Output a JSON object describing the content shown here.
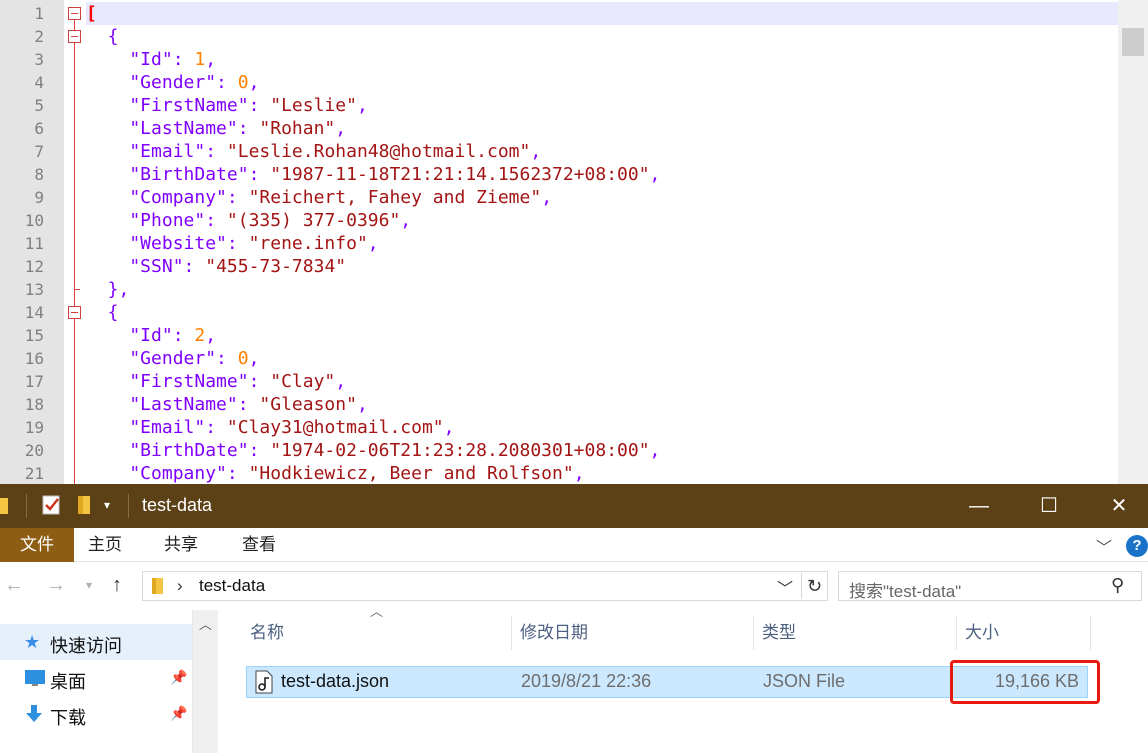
{
  "editor": {
    "lines": [
      {
        "n": "1",
        "tokens": [
          [
            "bracket",
            "["
          ]
        ]
      },
      {
        "n": "2",
        "tokens": [
          [
            "punct",
            "  {"
          ]
        ]
      },
      {
        "n": "3",
        "tokens": [
          [
            "key",
            "    \"Id\""
          ],
          [
            "punct",
            ": "
          ],
          [
            "num",
            "1"
          ],
          [
            "punct",
            ","
          ]
        ]
      },
      {
        "n": "4",
        "tokens": [
          [
            "key",
            "    \"Gender\""
          ],
          [
            "punct",
            ": "
          ],
          [
            "num",
            "0"
          ],
          [
            "punct",
            ","
          ]
        ]
      },
      {
        "n": "5",
        "tokens": [
          [
            "key",
            "    \"FirstName\""
          ],
          [
            "punct",
            ": "
          ],
          [
            "str",
            "\"Leslie\""
          ],
          [
            "punct",
            ","
          ]
        ]
      },
      {
        "n": "6",
        "tokens": [
          [
            "key",
            "    \"LastName\""
          ],
          [
            "punct",
            ": "
          ],
          [
            "str",
            "\"Rohan\""
          ],
          [
            "punct",
            ","
          ]
        ]
      },
      {
        "n": "7",
        "tokens": [
          [
            "key",
            "    \"Email\""
          ],
          [
            "punct",
            ": "
          ],
          [
            "str",
            "\"Leslie.Rohan48@hotmail.com\""
          ],
          [
            "punct",
            ","
          ]
        ]
      },
      {
        "n": "8",
        "tokens": [
          [
            "key",
            "    \"BirthDate\""
          ],
          [
            "punct",
            ": "
          ],
          [
            "str",
            "\"1987-11-18T21:21:14.1562372+08:00\""
          ],
          [
            "punct",
            ","
          ]
        ]
      },
      {
        "n": "9",
        "tokens": [
          [
            "key",
            "    \"Company\""
          ],
          [
            "punct",
            ": "
          ],
          [
            "str",
            "\"Reichert, Fahey and Zieme\""
          ],
          [
            "punct",
            ","
          ]
        ]
      },
      {
        "n": "10",
        "tokens": [
          [
            "key",
            "    \"Phone\""
          ],
          [
            "punct",
            ": "
          ],
          [
            "str",
            "\"(335) 377-0396\""
          ],
          [
            "punct",
            ","
          ]
        ]
      },
      {
        "n": "11",
        "tokens": [
          [
            "key",
            "    \"Website\""
          ],
          [
            "punct",
            ": "
          ],
          [
            "str",
            "\"rene.info\""
          ],
          [
            "punct",
            ","
          ]
        ]
      },
      {
        "n": "12",
        "tokens": [
          [
            "key",
            "    \"SSN\""
          ],
          [
            "punct",
            ": "
          ],
          [
            "str",
            "\"455-73-7834\""
          ]
        ]
      },
      {
        "n": "13",
        "tokens": [
          [
            "punct",
            "  },"
          ]
        ]
      },
      {
        "n": "14",
        "tokens": [
          [
            "punct",
            "  {"
          ]
        ]
      },
      {
        "n": "15",
        "tokens": [
          [
            "key",
            "    \"Id\""
          ],
          [
            "punct",
            ": "
          ],
          [
            "num",
            "2"
          ],
          [
            "punct",
            ","
          ]
        ]
      },
      {
        "n": "16",
        "tokens": [
          [
            "key",
            "    \"Gender\""
          ],
          [
            "punct",
            ": "
          ],
          [
            "num",
            "0"
          ],
          [
            "punct",
            ","
          ]
        ]
      },
      {
        "n": "17",
        "tokens": [
          [
            "key",
            "    \"FirstName\""
          ],
          [
            "punct",
            ": "
          ],
          [
            "str",
            "\"Clay\""
          ],
          [
            "punct",
            ","
          ]
        ]
      },
      {
        "n": "18",
        "tokens": [
          [
            "key",
            "    \"LastName\""
          ],
          [
            "punct",
            ": "
          ],
          [
            "str",
            "\"Gleason\""
          ],
          [
            "punct",
            ","
          ]
        ]
      },
      {
        "n": "19",
        "tokens": [
          [
            "key",
            "    \"Email\""
          ],
          [
            "punct",
            ": "
          ],
          [
            "str",
            "\"Clay31@hotmail.com\""
          ],
          [
            "punct",
            ","
          ]
        ]
      },
      {
        "n": "20",
        "tokens": [
          [
            "key",
            "    \"BirthDate\""
          ],
          [
            "punct",
            ": "
          ],
          [
            "str",
            "\"1974-02-06T21:23:28.2080301+08:00\""
          ],
          [
            "punct",
            ","
          ]
        ]
      },
      {
        "n": "21",
        "tokens": [
          [
            "key",
            "    \"Company\""
          ],
          [
            "punct",
            ": "
          ],
          [
            "str",
            "\"Hodkiewicz, Beer and Rolfson\""
          ],
          [
            "punct",
            ","
          ]
        ]
      }
    ],
    "fold_open_lines": [
      1,
      2,
      14
    ],
    "fold_end_lines": [
      13
    ]
  },
  "explorer": {
    "window_title": "test-data",
    "window_buttons": {
      "minimize": "—",
      "maximize": "☐",
      "close": "✕"
    },
    "ribbon_tabs": [
      {
        "label": "文件",
        "active": true
      },
      {
        "label": "主页",
        "active": false
      },
      {
        "label": "共享",
        "active": false
      },
      {
        "label": "查看",
        "active": false
      }
    ],
    "help_label": "?",
    "address": {
      "path": "test-data"
    },
    "search": {
      "placeholder": "搜索\"test-data\""
    },
    "nav_items": [
      {
        "label": "快速访问",
        "icon": "star-icon",
        "pinned": false,
        "selected": true
      },
      {
        "label": "桌面",
        "icon": "desktop-icon",
        "pinned": true,
        "selected": false
      },
      {
        "label": "下载",
        "icon": "download-icon",
        "pinned": true,
        "selected": false
      }
    ],
    "columns": [
      "名称",
      "修改日期",
      "类型",
      "大小"
    ],
    "files": [
      {
        "name": "test-data.json",
        "modified": "2019/8/21 22:36",
        "type": "JSON File",
        "size": "19,166 KB"
      }
    ]
  },
  "colors": {
    "titlebar": "#5c4016",
    "active_tab": "#8c5d12",
    "selection": "#cce8ff",
    "highlight_annotation": "#e8190f"
  }
}
